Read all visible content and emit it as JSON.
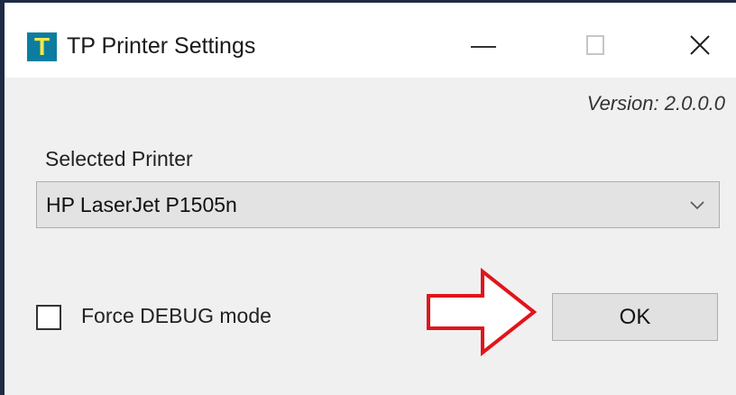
{
  "window": {
    "title": "TP Printer Settings",
    "icon_letter": "T",
    "colors": {
      "icon_bg": "#0c7da0",
      "icon_fg": "#f2e84a",
      "arrow": "#e0151b"
    }
  },
  "version_text": "Version: 2.0.0.0",
  "printer": {
    "label": "Selected Printer",
    "selected": "HP LaserJet P1505n"
  },
  "debug": {
    "label": "Force DEBUG mode",
    "checked": false
  },
  "buttons": {
    "ok": "OK"
  }
}
